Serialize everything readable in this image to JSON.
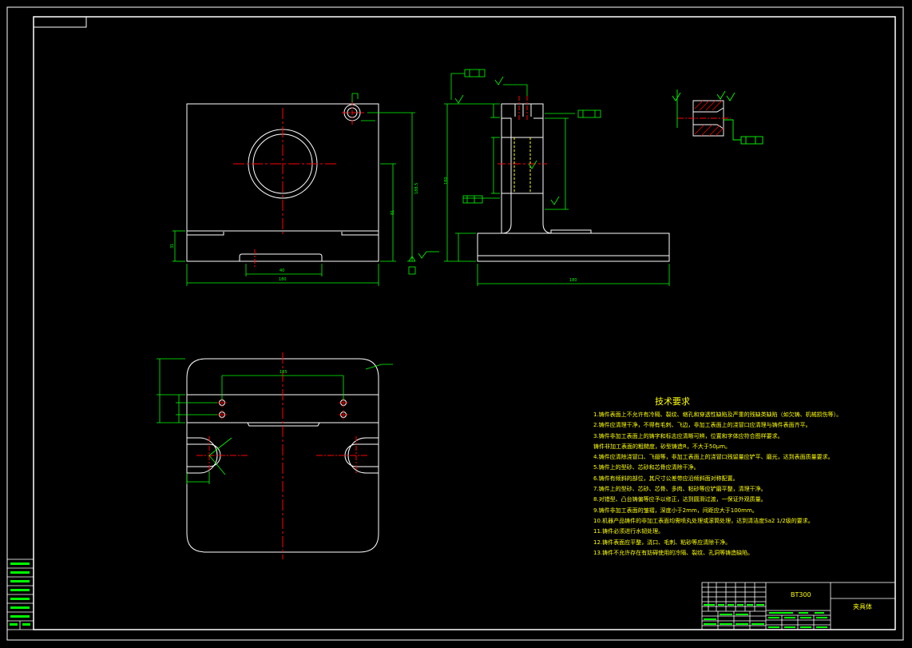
{
  "title_block": {
    "drawing_no": "BT300",
    "part_name": "夹具体"
  },
  "tech_requirements": {
    "title": "技术要求",
    "items": [
      "1.铸件表面上不允许有冷隔、裂纹、缩孔和穿透性缺陷及严重的残缺类缺陷（如欠铸、机械损伤等）。",
      "2.铸件应清理干净，不得有毛刺、飞边，非加工表面上的浇冒口应清理与铸件表面齐平。",
      "3.铸件非加工表面上的铸字和标志应清晰可辨，位置和字体应符合图样要求。",
      "   铸件非加工表面的粗糙度，砂型铸造R，不大于50μm。",
      "4.铸件应清除浇冒口、飞翅等，非加工表面上的浇冒口残留量应铲平、磨光，达到表面质量要求。",
      "5.铸件上的型砂、芯砂和芯骨应清除干净。",
      "6.铸件有倾斜的部位，其尺寸公差带应沿倾斜面对称配置。",
      "7.铸件上的型砂、芯砂、芯骨、多肉、粘砂等应铲磨平整，清理干净。",
      "8.对错型、凸台铸偏等应予以修正，达到圆滑过渡，一保证外观质量。",
      "9.铸件非加工表面的皱褶，深度小于2mm，间距应大于100mm。",
      "10.机器产品铸件的非加工表面均需喷丸处理或滚筒处理，达到清洁度Sa2 1/2级的要求。",
      "11.铸件必须进行水韧处理。",
      "12.铸件表面应平整，浇口、毛刺、粘砂等应清除干净。",
      "13.铸件不允许存在有妨碍使用的冷隔、裂纹、孔洞等铸造缺陷。"
    ]
  },
  "dimensions": {
    "front_width": "180",
    "front_height": "188.5",
    "front_height2": "81",
    "front_base": "31",
    "front_slot": "40",
    "side_width": "180",
    "side_height": "180",
    "plan_top": "185"
  },
  "colors": {
    "outline": "#ffffff",
    "dimension": "#00ff00",
    "centerline": "#ff0000",
    "note_text": "#ffff00",
    "hidden": "#ffff00",
    "symbol": "#00ffff"
  }
}
